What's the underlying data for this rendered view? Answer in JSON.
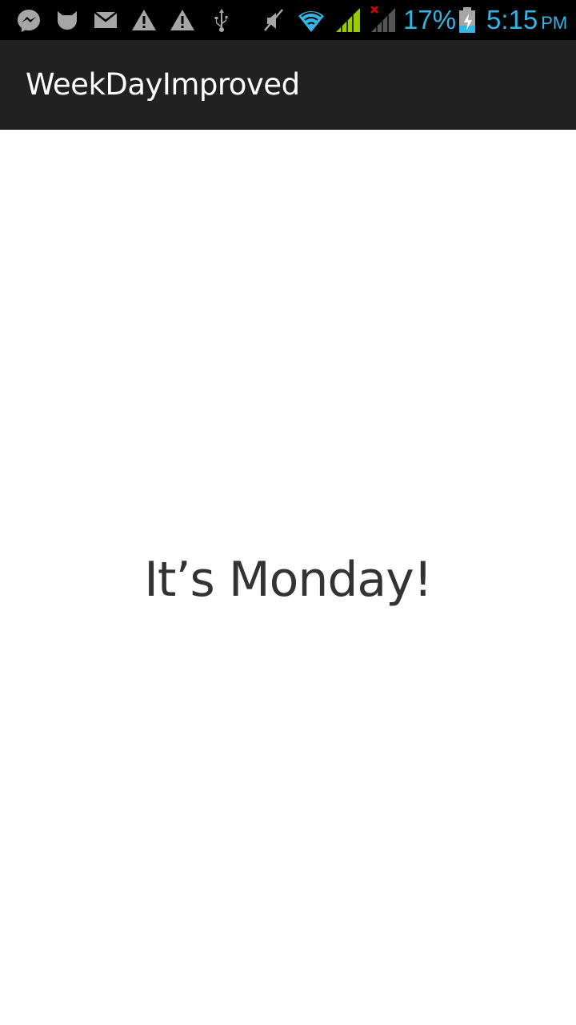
{
  "status_bar": {
    "icons": [
      "messenger-icon",
      "cat-notification-icon",
      "email-icon",
      "warning-icon",
      "warning-icon",
      "usb-icon",
      "mute-icon",
      "wifi-icon",
      "cell-signal-icon",
      "cell-signal-no-service-icon",
      "battery-charging-icon"
    ],
    "battery_percent": "17%",
    "clock_time": "5:15",
    "clock_ampm": "PM",
    "accent_color": "#33b5e5",
    "signal_color": "#99cc00"
  },
  "action_bar": {
    "title": "WeekDayImproved"
  },
  "main": {
    "message": "It’s Monday!"
  }
}
